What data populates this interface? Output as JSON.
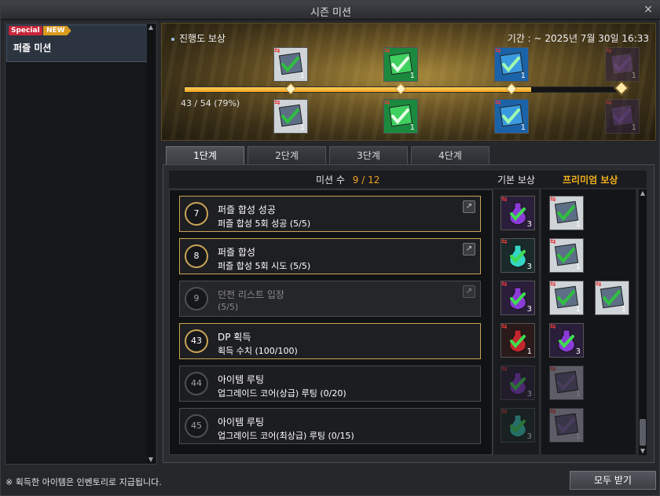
{
  "window": {
    "title": "시즌 미션",
    "close_glyph": "×"
  },
  "sidebar": {
    "badge_special": "Special",
    "badge_new": "NEW",
    "item_label": "퍼즐 미션"
  },
  "progress_reward": {
    "label": "진행도 보상",
    "period": "기간 : ~ 2025년 7월 30일 16:33",
    "progress_text": "43 / 54 (79%)",
    "progress_fraction": 0.79,
    "milestones": [
      0.25,
      0.5,
      0.75,
      1.0
    ],
    "top_items": [
      {
        "icon": "puzzle-blueprint-icon",
        "count": "1"
      },
      {
        "icon": "puzzle-green-icon",
        "count": "1"
      },
      {
        "icon": "puzzle-blue-icon",
        "count": "1"
      },
      {
        "icon": "puzzle-purple-icon",
        "count": "1"
      }
    ],
    "bottom_items": [
      {
        "icon": "puzzle-blueprint-icon",
        "count": "1"
      },
      {
        "icon": "puzzle-green-icon",
        "count": "1"
      },
      {
        "icon": "puzzle-blue-icon",
        "count": "1"
      },
      {
        "icon": "puzzle-purple-icon",
        "count": "1"
      }
    ]
  },
  "tabs": [
    "1단계",
    "2단계",
    "3단계",
    "4단계"
  ],
  "header": {
    "mission_count_label": "미션 수",
    "mission_count_value": "9 / 12",
    "basic_reward": "기본 보상",
    "premium_reward": "프리미엄 보상"
  },
  "missions": [
    {
      "num": "7",
      "title": "퍼즐 합성 성공",
      "desc": "퍼즐 합성 5회 성공 (5/5)",
      "basic": {
        "icon": "purple-potion-icon",
        "count": "3"
      },
      "premium": [
        {
          "icon": "puzzle-blueprint-icon",
          "count": "1"
        }
      ]
    },
    {
      "num": "8",
      "title": "퍼즐 합성",
      "desc": "퍼즐 합성 5회 시도 (5/5)",
      "basic": {
        "icon": "cyan-potion-icon",
        "count": "3"
      },
      "premium": [
        {
          "icon": "puzzle-blueprint-icon",
          "count": "1"
        }
      ]
    },
    {
      "num": "9",
      "title": "던전 리스트 입장",
      "desc": "(5/5)",
      "basic": {
        "icon": "purple-potion-icon",
        "count": "3"
      },
      "premium": [
        {
          "icon": "puzzle-blueprint-icon",
          "count": "1"
        },
        {
          "icon": "puzzle-blueprint-icon",
          "count": "1"
        }
      ]
    },
    {
      "num": "43",
      "title": "DP 획득",
      "desc": "획득 수치 (100/100)",
      "basic": {
        "icon": "red-potion-icon",
        "count": "1"
      },
      "premium": [
        {
          "icon": "purple-potion-icon",
          "count": "3"
        }
      ]
    },
    {
      "num": "44",
      "title": "아이템 루팅",
      "desc": "업그레이드 코어(상급) 루팅  (0/20)",
      "basic": {
        "icon": "purple-potion-icon",
        "count": "3"
      },
      "premium": [
        {
          "icon": "puzzle-map-icon",
          "count": "1"
        }
      ]
    },
    {
      "num": "45",
      "title": "아이템 루팅",
      "desc": "업그레이드 코어(최상급) 루팅  (0/15)",
      "basic": {
        "icon": "cyan-potion-icon",
        "count": "3"
      },
      "premium": [
        {
          "icon": "puzzle-map-icon",
          "count": "1"
        }
      ]
    }
  ],
  "footer": {
    "note": "※ 획득한 아이템은 인벤토리로 지급됩니다.",
    "claim_all": "모두 받기"
  },
  "colors": {
    "accent_gold": "#f2a21c",
    "premium_text": "#f2b01c",
    "count_orange": "#f2a21c"
  }
}
